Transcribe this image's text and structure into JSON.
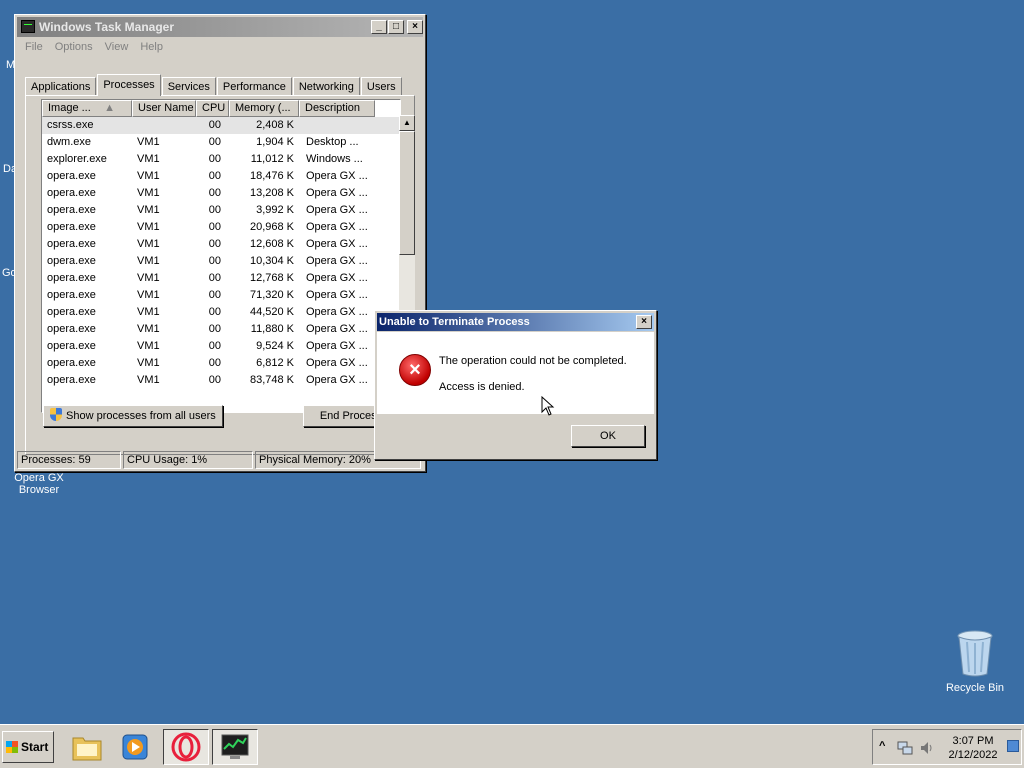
{
  "desktop": {
    "fragments": [
      "M",
      "Da",
      "Go"
    ],
    "opera_icon_label": "Opera GX Browser",
    "recycle_bin_label": "Recycle Bin"
  },
  "taskmgr": {
    "title": "Windows Task Manager",
    "menu": [
      "File",
      "Options",
      "View",
      "Help"
    ],
    "tabs": [
      "Applications",
      "Processes",
      "Services",
      "Performance",
      "Networking",
      "Users"
    ],
    "active_tab": "Processes",
    "columns": [
      "Image ...",
      "User Name",
      "CPU",
      "Memory (...",
      "Description"
    ],
    "rows": [
      {
        "name": "csrss.exe",
        "user": "",
        "cpu": "00",
        "mem": "2,408 K",
        "desc": ""
      },
      {
        "name": "dwm.exe",
        "user": "VM1",
        "cpu": "00",
        "mem": "1,904 K",
        "desc": "Desktop ..."
      },
      {
        "name": "explorer.exe",
        "user": "VM1",
        "cpu": "00",
        "mem": "11,012 K",
        "desc": "Windows ..."
      },
      {
        "name": "opera.exe",
        "user": "VM1",
        "cpu": "00",
        "mem": "18,476 K",
        "desc": "Opera GX ..."
      },
      {
        "name": "opera.exe",
        "user": "VM1",
        "cpu": "00",
        "mem": "13,208 K",
        "desc": "Opera GX ..."
      },
      {
        "name": "opera.exe",
        "user": "VM1",
        "cpu": "00",
        "mem": "3,992 K",
        "desc": "Opera GX ..."
      },
      {
        "name": "opera.exe",
        "user": "VM1",
        "cpu": "00",
        "mem": "20,968 K",
        "desc": "Opera GX ..."
      },
      {
        "name": "opera.exe",
        "user": "VM1",
        "cpu": "00",
        "mem": "12,608 K",
        "desc": "Opera GX ..."
      },
      {
        "name": "opera.exe",
        "user": "VM1",
        "cpu": "00",
        "mem": "10,304 K",
        "desc": "Opera GX ..."
      },
      {
        "name": "opera.exe",
        "user": "VM1",
        "cpu": "00",
        "mem": "12,768 K",
        "desc": "Opera GX ..."
      },
      {
        "name": "opera.exe",
        "user": "VM1",
        "cpu": "00",
        "mem": "71,320 K",
        "desc": "Opera GX ..."
      },
      {
        "name": "opera.exe",
        "user": "VM1",
        "cpu": "00",
        "mem": "44,520 K",
        "desc": "Opera GX ..."
      },
      {
        "name": "opera.exe",
        "user": "VM1",
        "cpu": "00",
        "mem": "11,880 K",
        "desc": "Opera GX ..."
      },
      {
        "name": "opera.exe",
        "user": "VM1",
        "cpu": "00",
        "mem": "9,524 K",
        "desc": "Opera GX ..."
      },
      {
        "name": "opera.exe",
        "user": "VM1",
        "cpu": "00",
        "mem": "6,812 K",
        "desc": "Opera GX ..."
      },
      {
        "name": "opera.exe",
        "user": "VM1",
        "cpu": "00",
        "mem": "83,748 K",
        "desc": "Opera GX ..."
      }
    ],
    "show_all_label": "Show processes from all users",
    "end_process_label": "End Process",
    "status": {
      "processes": "Processes: 59",
      "cpu": "CPU Usage: 1%",
      "memory": "Physical Memory: 20%"
    }
  },
  "dialog": {
    "title": "Unable to Terminate Process",
    "message": "The operation could not be completed.",
    "detail": "Access is denied.",
    "ok_label": "OK"
  },
  "taskbar": {
    "start_label": "Start",
    "time": "3:07 PM",
    "date": "2/12/2022"
  }
}
